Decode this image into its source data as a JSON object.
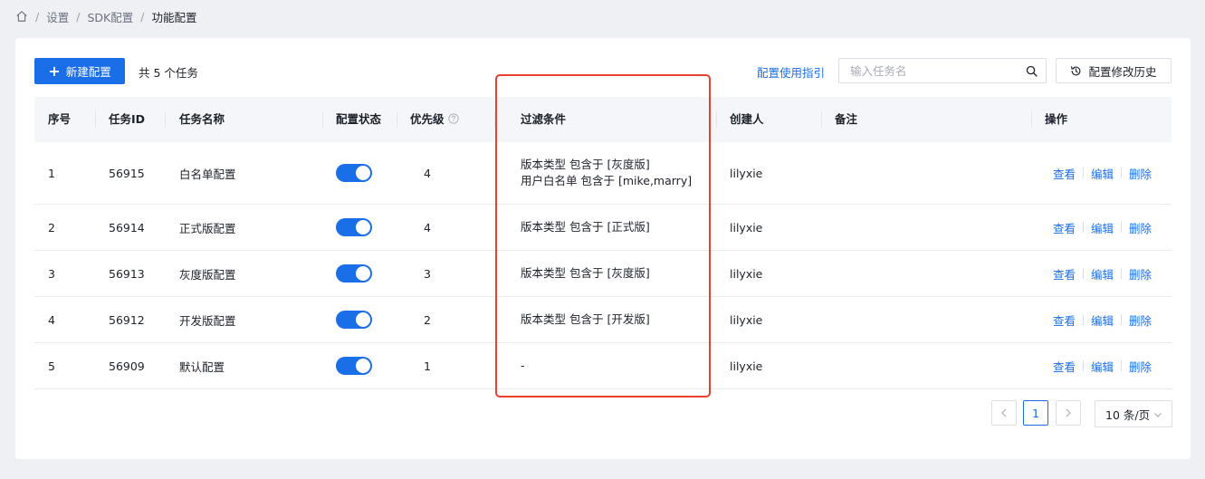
{
  "breadcrumb": {
    "items": [
      "设置",
      "SDK配置",
      "功能配置"
    ],
    "separator": "/"
  },
  "toolbar": {
    "new_button_label": "新建配置",
    "total_text": "共 5 个任务",
    "guide_link": "配置使用指引",
    "search_placeholder": "输入任务名",
    "history_button_label": "配置修改历史"
  },
  "table": {
    "columns": [
      "序号",
      "任务ID",
      "任务名称",
      "配置状态",
      "优先级",
      "过滤条件",
      "创建人",
      "备注",
      "操作"
    ],
    "rows": [
      {
        "index": "1",
        "id": "56915",
        "name": "白名单配置",
        "enabled": true,
        "priority": "4",
        "filters": [
          "版本类型 包含于 [灰度版]",
          "用户白名单 包含于 [mike,marry]"
        ],
        "creator": "lilyxie",
        "note": "",
        "ops": [
          "查看",
          "编辑",
          "删除"
        ]
      },
      {
        "index": "2",
        "id": "56914",
        "name": "正式版配置",
        "enabled": true,
        "priority": "4",
        "filters": [
          "版本类型 包含于 [正式版]"
        ],
        "creator": "lilyxie",
        "note": "",
        "ops": [
          "查看",
          "编辑",
          "删除"
        ]
      },
      {
        "index": "3",
        "id": "56913",
        "name": "灰度版配置",
        "enabled": true,
        "priority": "3",
        "filters": [
          "版本类型 包含于 [灰度版]"
        ],
        "creator": "lilyxie",
        "note": "",
        "ops": [
          "查看",
          "编辑",
          "删除"
        ]
      },
      {
        "index": "4",
        "id": "56912",
        "name": "开发版配置",
        "enabled": true,
        "priority": "2",
        "filters": [
          "版本类型 包含于 [开发版]"
        ],
        "creator": "lilyxie",
        "note": "",
        "ops": [
          "查看",
          "编辑",
          "删除"
        ]
      },
      {
        "index": "5",
        "id": "56909",
        "name": "默认配置",
        "enabled": true,
        "priority": "1",
        "filters": [
          "-"
        ],
        "creator": "lilyxie",
        "note": "",
        "ops": [
          "查看",
          "编辑",
          "删除"
        ]
      }
    ]
  },
  "pagination": {
    "current_page": "1",
    "page_size_label": "10 条/页"
  },
  "colors": {
    "primary": "#1a6ee8",
    "highlight_border": "#e8412f",
    "header_bg": "#f4f6f9"
  },
  "icons": {
    "home": "home-icon",
    "plus": "plus-icon",
    "search": "search-icon",
    "history": "history-icon",
    "help": "help-icon",
    "prev": "chevron-left-icon",
    "next": "chevron-right-icon",
    "dropdown": "chevron-down-icon"
  }
}
